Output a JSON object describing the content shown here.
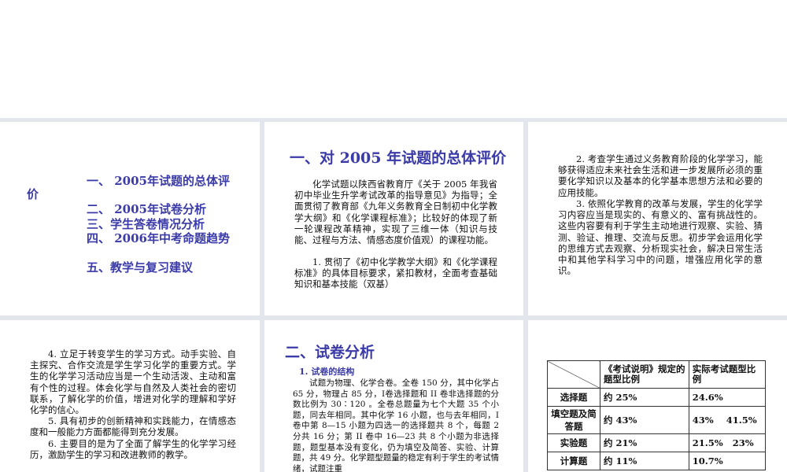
{
  "slide1": {
    "toc": [
      "一、 2005年试题的总体评",
      "价",
      "二、 2005年试卷分析",
      "三、学生答卷情况分析",
      "四、 2006年中考命题趋势",
      "五、教学与复习建议"
    ]
  },
  "slide2": {
    "title": "一、对 2005 年试题的总体评价",
    "paragraphs": [
      "化学试题以陕西省教育厅《关于 2005 年我省初中毕业生升学考试改革的指导意见》为指导；全面贯彻了教育部《九年义务教育全日制初中化学教学大纲》和《化学课程标准》；比较好的体现了新一轮课程改革精神，实现了三维一体（知识与技能、过程与方法、情感态度价值观）的课程功能。",
      "1. 贯彻了《初中化学教学大纲》和《化学课程标准》的具体目标要求，紧扣教材，全面考查基础知识和基本技能（双基）"
    ]
  },
  "slide3": {
    "paragraphs": [
      "2. 考查学生通过义务教育阶段的化学学习，能够获得适应未来社会生活和进一步发展所必须的重要化学知识以及基本的化学基本思想方法和必要的应用技能。",
      "3. 依照化学教育的改革与发展，学生的化学学习内容应当是现实的、有意义的、富有挑战性的。这些内容要有利于学生主动地进行观察、实验、猜测、验证、推理、交流与反思。初步学会运用化学的思维方式去观察、分析现实社会，解决日常生活中和其他学科学习中的问题，增强应用化学的意识。"
    ]
  },
  "slide4": {
    "paragraphs": [
      "4. 立足于转变学生的学习方式。动手实验、自主探究、合作交流是学生学习化学的重要方式。学生的化学学习活动应当是一个生动活泼、主动和富有个性的过程。体会化学与自然及人类社会的密切联系，了解化学的价值，增进对化学的理解和学好化学的信心。",
      "5. 具有初步的创新精神和实践能力，在情感态度和一般能力方面都能得到充分发展。",
      "6. 主要目的是为了全面了解学生的化学学习经历，激励学生的学习和改进教师的教学。"
    ]
  },
  "slide5": {
    "title": "二、试卷分析",
    "subhead": "1. 试卷的结构",
    "paragraph": "试题为物理、化学合卷。全卷 150 分，其中化学占 65 分，物理占 85 分，Ⅰ卷选择题和 II 卷非选择题的分数比例为 30∶120 。全卷总题量为七个大题 35 个小题，同去年相同。其中化学 16 小题，也与去年相同，Ⅰ卷中第 8—15 小题为四选一的选择题共 8 个，每题 2 分共 16 分；第 II 卷中 16—23 共 8 个小题为非选择题，题型基本没有变化，仍为填空及简答、实验、计算题，共 49 分。化学题型题量的稳定有利于学生的考试情绪，试题注重"
  },
  "slide6": {
    "table": {
      "header": [
        "《考试说明》规定的题型比例",
        "实际考试题型比例"
      ],
      "rows": [
        {
          "label": "选择题",
          "spec": "约 25%",
          "actual": "24.6%"
        },
        {
          "label": "填空题及简答题",
          "spec": "约 43%",
          "actual": "43%    41.5%"
        },
        {
          "label": "实验题",
          "spec": "约 21%",
          "actual": "21.5%   23%"
        },
        {
          "label": "计算题",
          "spec": "约 11%",
          "actual": "10.7%"
        }
      ]
    }
  },
  "colors": {
    "accent": "#3a3aa8",
    "gap": "#e3e6ec",
    "slide_bg": "#ffffff"
  }
}
